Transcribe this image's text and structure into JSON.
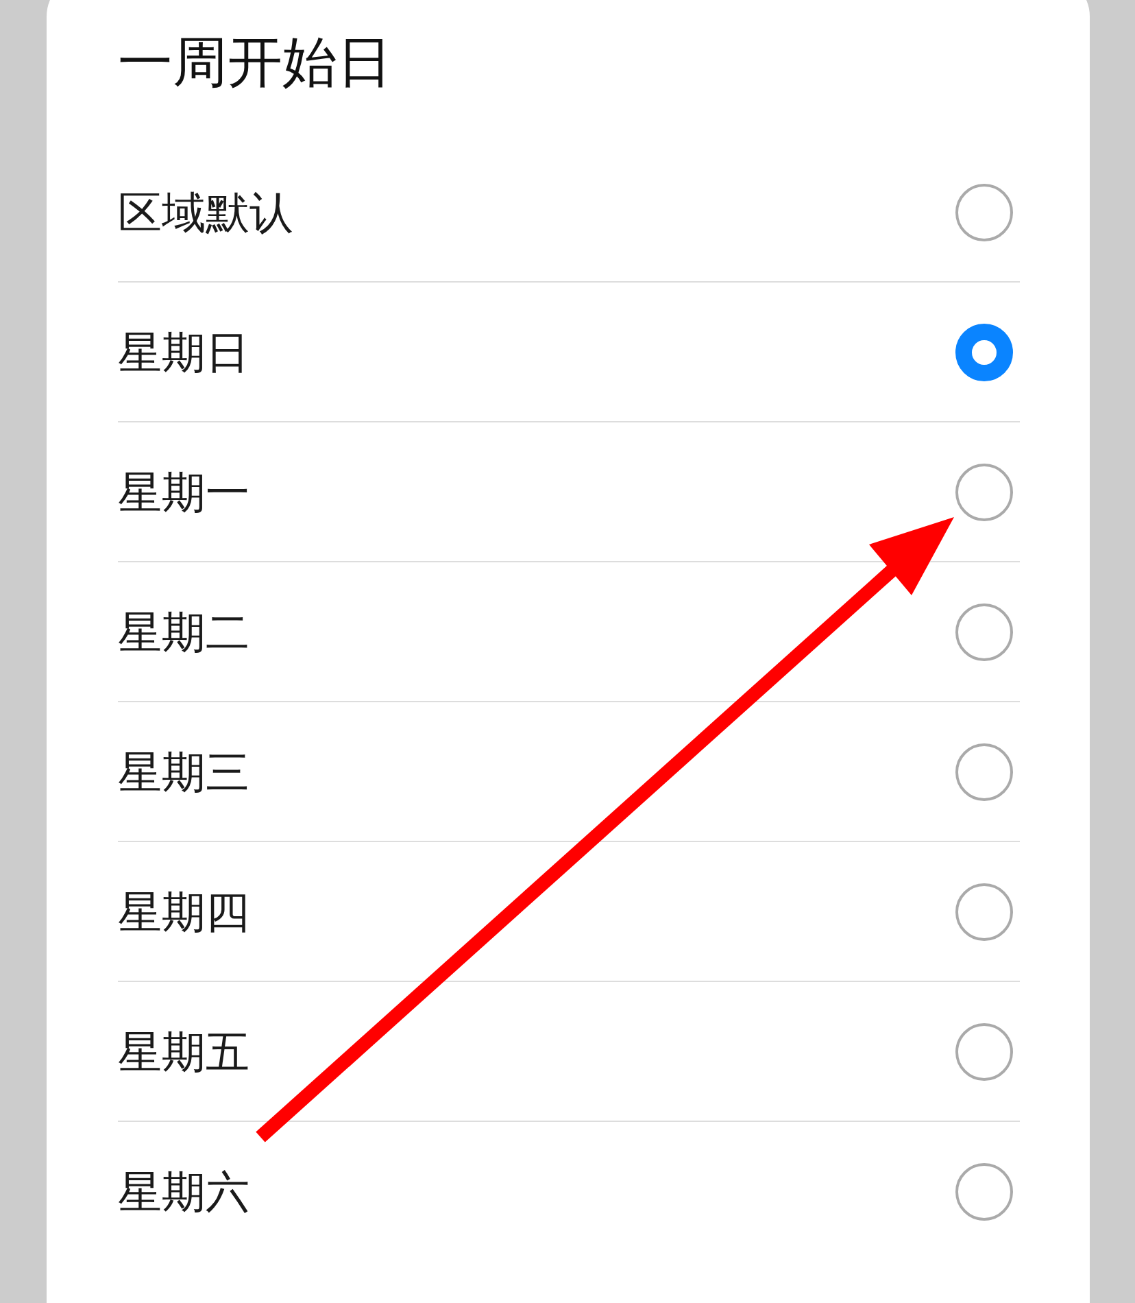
{
  "title": "一周开始日",
  "options": [
    {
      "label": "区域默认",
      "selected": false
    },
    {
      "label": "星期日",
      "selected": true
    },
    {
      "label": "星期一",
      "selected": false
    },
    {
      "label": "星期二",
      "selected": false
    },
    {
      "label": "星期三",
      "selected": false
    },
    {
      "label": "星期四",
      "selected": false
    },
    {
      "label": "星期五",
      "selected": false
    },
    {
      "label": "星期六",
      "selected": false
    }
  ]
}
